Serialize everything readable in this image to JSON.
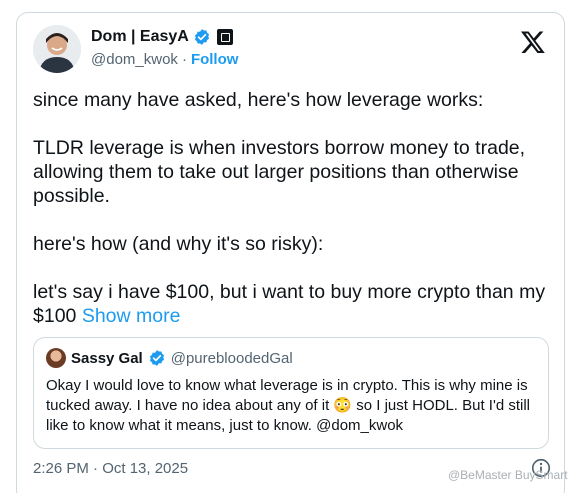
{
  "author": {
    "display_name": "Dom | EasyA",
    "handle": "@dom_kwok",
    "separator": "·",
    "follow_label": "Follow"
  },
  "tweet": {
    "paragraphs": [
      "since many have asked, here's how leverage works:",
      "TLDR leverage is when investors borrow money to trade, allowing them to take out larger positions than otherwise possible.",
      "here's how (and why it's so risky):",
      "let's say i have $100, but i want to buy more crypto than my $100"
    ],
    "show_more_label": "Show more",
    "timestamp": "2:26 PM · Oct 13, 2025"
  },
  "quoted_tweet": {
    "display_name": "Sassy Gal",
    "handle": "@purebloodedGal",
    "text": "Okay I would love to know what leverage is in crypto. This is why mine is tucked away. I have no idea about any of it 😳 so I just HODL. But I'd still like to know what it means, just to know. @dom_kwok"
  },
  "watermark": "@BeMaster BuySmart",
  "colors": {
    "link": "#1d9bf0",
    "secondary_text": "#536471",
    "border": "#cfd9de",
    "verified": "#1d9bf0"
  },
  "icons": [
    "verified-badge-icon",
    "affiliate-badge-icon",
    "x-logo-icon",
    "info-icon"
  ]
}
